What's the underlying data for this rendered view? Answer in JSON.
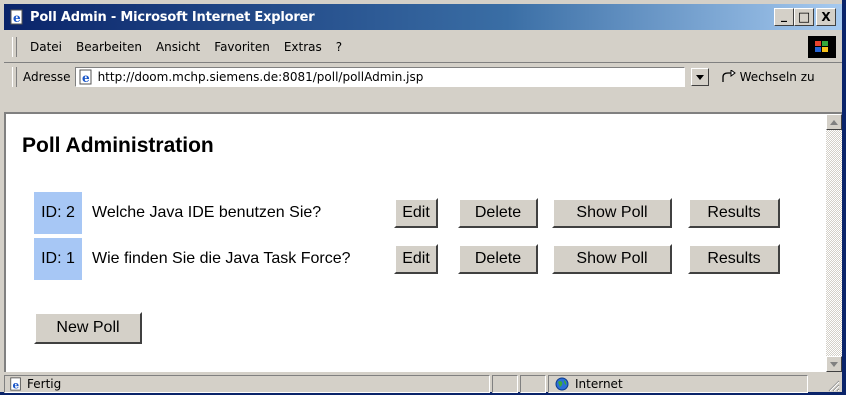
{
  "window": {
    "title": "Poll Admin - Microsoft Internet Explorer",
    "controls": {
      "minimize": "_",
      "maximize": "□",
      "close": "X"
    }
  },
  "menu": {
    "items": [
      "Datei",
      "Bearbeiten",
      "Ansicht",
      "Favoriten",
      "Extras",
      "?"
    ]
  },
  "address": {
    "label": "Adresse",
    "url": "http://doom.mchp.siemens.de:8081/poll/pollAdmin.jsp",
    "go_label": "Wechseln zu"
  },
  "page": {
    "heading": "Poll Administration",
    "polls": [
      {
        "id_label": "ID: 2",
        "question": "Welche Java IDE benutzen Sie?"
      },
      {
        "id_label": "ID: 1",
        "question": "Wie finden Sie die Java Task Force?"
      }
    ],
    "buttons": {
      "edit": "Edit",
      "delete": "Delete",
      "show_poll": "Show Poll",
      "results": "Results",
      "new_poll": "New Poll"
    }
  },
  "status": {
    "text": "Fertig",
    "zone": "Internet"
  },
  "colors": {
    "titlebar_start": "#0a246a",
    "titlebar_end": "#a6caf0",
    "chrome": "#d4d0c8",
    "id_cell": "#a7c7f5"
  },
  "icons": {
    "app": "ie-page-icon",
    "go": "go-arrow-icon",
    "zone": "globe-icon"
  }
}
